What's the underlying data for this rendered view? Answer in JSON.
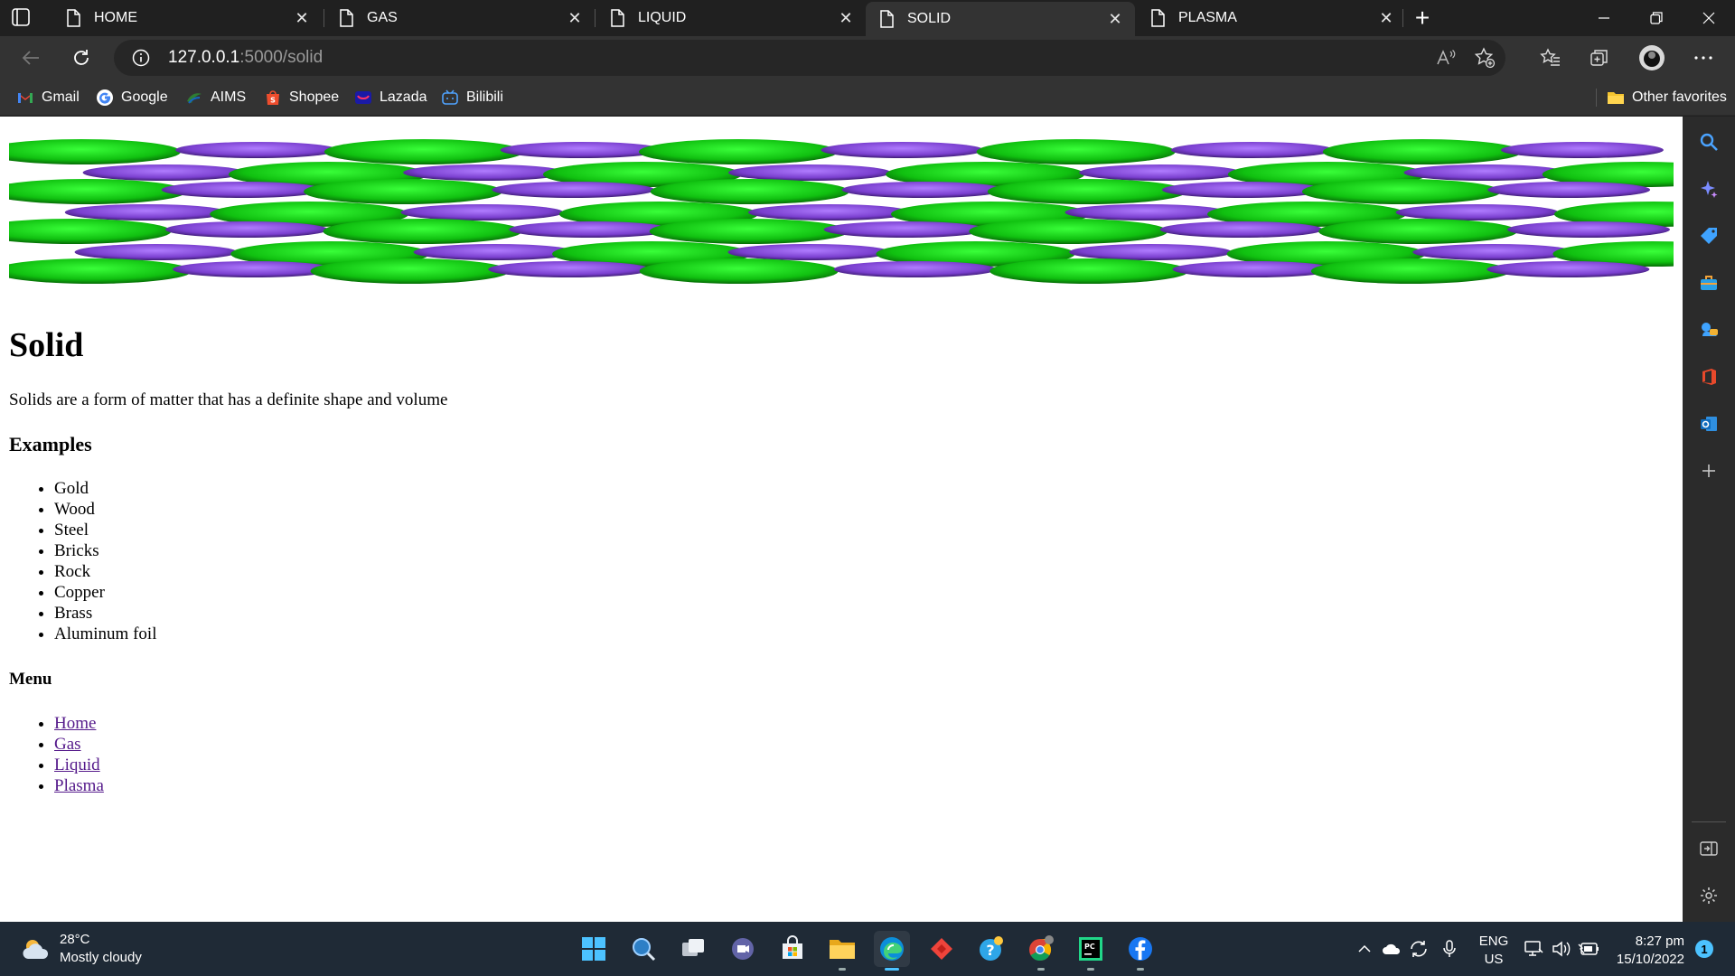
{
  "browser": {
    "tabs": [
      {
        "label": "HOME",
        "active": false
      },
      {
        "label": "GAS",
        "active": false
      },
      {
        "label": "LIQUID",
        "active": false
      },
      {
        "label": "SOLID",
        "active": true
      },
      {
        "label": "PLASMA",
        "active": false
      }
    ],
    "address": {
      "host": "127.0.0.1",
      "path": ":5000/solid"
    },
    "favorites": [
      "Gmail",
      "Google",
      "AIMS",
      "Shopee",
      "Lazada",
      "Bilibili"
    ],
    "other_favorites": "Other favorites"
  },
  "page": {
    "title": "Solid",
    "description": "Solids are a form of matter that has a definite shape and volume",
    "examples_heading": "Examples",
    "examples": [
      "Gold",
      "Wood",
      "Steel",
      "Bricks",
      "Rock",
      "Copper",
      "Brass",
      "Aluminum foil"
    ],
    "menu_heading": "Menu",
    "menu": [
      "Home",
      "Gas",
      "Liquid",
      "Plasma"
    ],
    "banner_colors": {
      "green": "#1ed51e",
      "purple": "#8a4fd6"
    }
  },
  "taskbar": {
    "weather_temp": "28°C",
    "weather_desc": "Mostly cloudy",
    "lang_1": "ENG",
    "lang_2": "US",
    "time": "8:27 pm",
    "date": "15/10/2022",
    "notification_count": "1"
  },
  "colors": {
    "accent": "#4cc2ff",
    "link_visited": "#551a8b"
  }
}
